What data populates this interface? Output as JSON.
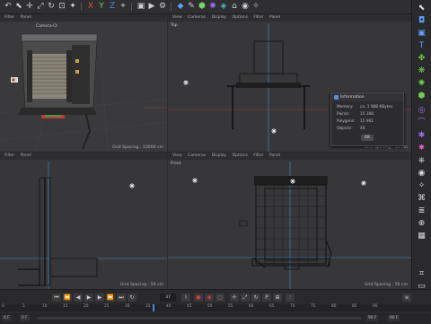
{
  "toolbar": {
    "axis_x": "X",
    "axis_y": "Y",
    "axis_z": "Z"
  },
  "viewports": {
    "perspective": {
      "menu": [
        "Filter",
        "Panel"
      ],
      "camera_label": "Camera·Ct",
      "grid_spacing": "Grid Spacing : 10000 cm"
    },
    "top": {
      "menu": [
        "View",
        "Cameras",
        "Display",
        "Options",
        "Filter",
        "Panel"
      ],
      "label": "Top",
      "grid_spacing": "Grid Spacing : 50 cm"
    },
    "right": {
      "menu": [
        "Filter",
        "Panel"
      ],
      "grid_spacing": "Grid Spacing : 50 cm"
    },
    "front": {
      "menu": [
        "View",
        "Cameras",
        "Display",
        "Options",
        "Filter",
        "Panel"
      ],
      "label": "Front",
      "grid_spacing": "Grid Spacing : 50 cm"
    }
  },
  "info_dialog": {
    "title": "Information",
    "rows": [
      {
        "label": "Memory:",
        "value": "ca. 1 988 KBytes"
      },
      {
        "label": "Points:",
        "value": "15 308"
      },
      {
        "label": "Polygons:",
        "value": "15 901"
      },
      {
        "label": "Objects:",
        "value": "46"
      }
    ],
    "ok_label": "OK"
  },
  "timeline": {
    "current_frame": "37",
    "ruler_ticks": [
      "0",
      "5",
      "10",
      "15",
      "20",
      "25",
      "30",
      "35",
      "40",
      "45",
      "50",
      "55",
      "60",
      "65",
      "70",
      "75",
      "80",
      "85",
      "90"
    ],
    "status_left": "0 F",
    "status_mid": "0 F",
    "status_right_a": "90 F",
    "status_right_b": "90 F"
  },
  "colors": {
    "accent_blue": "#3a8fe0",
    "axis_red": "#d23a3a",
    "record_red": "#d23a3a"
  }
}
